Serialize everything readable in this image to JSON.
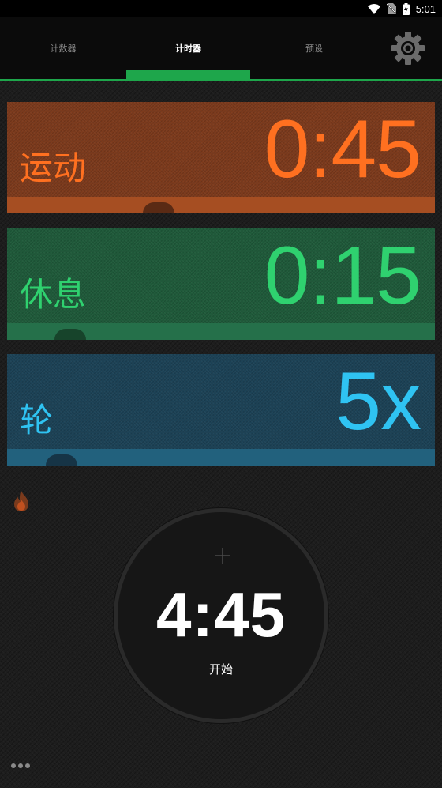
{
  "status_bar": {
    "time": "5:01",
    "icons": [
      "wifi-icon",
      "no-sim-icon",
      "battery-charging-icon"
    ]
  },
  "tabs": [
    {
      "label": "计数器",
      "active": false
    },
    {
      "label": "计时器",
      "active": true
    },
    {
      "label": "预设",
      "active": false
    }
  ],
  "settings_icon": "gear-icon",
  "accent_color": "#1ea64b",
  "cards": {
    "exercise": {
      "label": "运动",
      "value": "0:45",
      "color": "#ff7020"
    },
    "rest": {
      "label": "休息",
      "value": "0:15",
      "color": "#2fd16f"
    },
    "rounds": {
      "label": "轮",
      "value": "5x",
      "color": "#2fc3f2"
    }
  },
  "flame_icon": "flame-icon",
  "start_button": {
    "total_time": "4:45",
    "label": "开始",
    "plus_icon": "plus-icon"
  },
  "more_icon": "more-dots-icon"
}
